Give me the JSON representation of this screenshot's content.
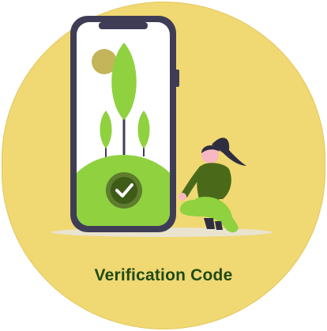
{
  "card": {
    "caption": "Verification Code",
    "illustration": "phone-verified-illustration",
    "icon": "checkmark-icon"
  },
  "colors": {
    "background": "#f0d873",
    "phone_frame": "#3f3d56",
    "grass": "#8fd13f",
    "check_badge": "#3e5b17",
    "caption_text": "#1f4a12"
  }
}
